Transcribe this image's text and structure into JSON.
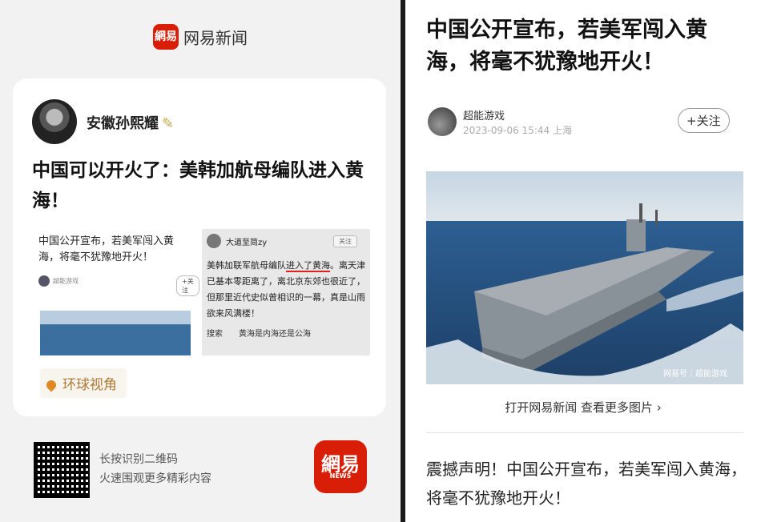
{
  "left": {
    "brand": {
      "logo": "網易",
      "name": "网易新闻"
    },
    "card": {
      "author": "安徽孙熙耀",
      "headline": "中国可以开火了：美韩加航母编队进入黄海！",
      "mini_left": {
        "title": "中国公开宣布，若美军闯入黄海，将毫不犹豫地开火！",
        "meta": "超能游戏",
        "follow": "+关注"
      },
      "mini_right": {
        "author": "大道至简zy",
        "follow": "关注",
        "body_pre": "美韩加联军航母编队",
        "body_underlined": "进入了黄海",
        "body_post": "。离天津已基本零距离了，离北京东郊也很近了，但那里近代史似曾相识的一幕，真是山雨欲来风满楼！",
        "footer": "搜索　　黄海是内海还是公海"
      },
      "tag": "环球视角"
    },
    "footer": {
      "qr_line1": "长按识别二维码",
      "qr_line2": "火速围观更多精彩内容",
      "app_icon": "網易",
      "app_icon_sub": "NEWS"
    }
  },
  "right": {
    "title": "中国公开宣布，若美军闯入黄海，将毫不犹豫地开火！",
    "author": "超能游戏",
    "date": "2023-09-06 15:44 上海",
    "follow": "+关注",
    "watermark": "网易号｜超能游戏",
    "more": "打开网易新闻 查看更多图片 ›",
    "body": "震撼声明！中国公开宣布，若美军闯入黄海，将毫不犹豫地开火！"
  }
}
